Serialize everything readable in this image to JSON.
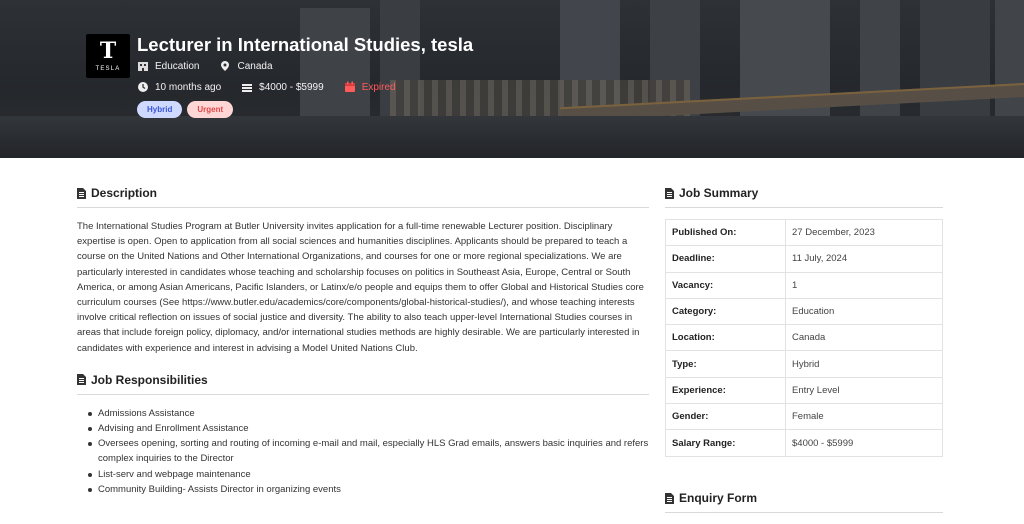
{
  "job": {
    "title": "Lecturer in International Studies, tesla",
    "company_logo_text": "TESLA",
    "category": "Education",
    "location": "Canada",
    "posted": "10 months ago",
    "salary": "$4000 - $5999",
    "status": "Expired",
    "badges": [
      "Hybrid",
      "Urgent"
    ]
  },
  "description": {
    "heading": "Description",
    "text": "The International Studies Program at Butler University invites application for a full-time renewable Lecturer position. Disciplinary expertise is open. Open to application from all social sciences and humanities disciplines. Applicants should be prepared to teach a course on the United Nations and Other International Organizations, and courses for one or more regional specializations. We are particularly interested in candidates whose teaching and scholarship focuses on politics in Southeast Asia, Europe, Central or South America, or among Asian Americans, Pacific Islanders, or Latinx/e/o people and equips them to offer Global and Historical Studies core curriculum courses (See https://www.butler.edu/academics/core/components/global-historical-studies/), and whose teaching interests involve critical reflection on issues of social justice and diversity. The ability to also teach upper-level International Studies courses in areas that include foreign policy, diplomacy, and/or international studies methods are highly desirable. We are particularly interested in candidates with experience and interest in advising a Model United Nations Club."
  },
  "responsibilities": {
    "heading": "Job Responsibilities",
    "items": [
      "Admissions Assistance",
      "Advising and Enrollment Assistance",
      "Oversees opening, sorting and routing of incoming e-mail and mail, especially HLS Grad emails, answers basic inquiries and refers complex inquiries to the Director",
      "List-serv and webpage maintenance",
      "Community Building- Assists Director in organizing events"
    ]
  },
  "summary": {
    "heading": "Job Summary",
    "rows": [
      {
        "label": "Published On:",
        "value": "27 December, 2023"
      },
      {
        "label": "Deadline:",
        "value": "11 July, 2024"
      },
      {
        "label": "Vacancy:",
        "value": "1"
      },
      {
        "label": "Category:",
        "value": "Education"
      },
      {
        "label": "Location:",
        "value": "Canada"
      },
      {
        "label": "Type:",
        "value": "Hybrid"
      },
      {
        "label": "Experience:",
        "value": "Entry Level"
      },
      {
        "label": "Gender:",
        "value": "Female"
      },
      {
        "label": "Salary Range:",
        "value": "$4000 - $5999"
      }
    ]
  },
  "enquiry": {
    "heading": "Enquiry Form"
  },
  "icons": {
    "document": "document-icon",
    "building": "building-icon",
    "location": "location-pin-icon",
    "clock": "clock-icon",
    "money": "money-icon",
    "calendar": "calendar-icon"
  },
  "colors": {
    "expired": "#ff5b5b",
    "hybrid_badge": "#cfd8ff",
    "urgent_badge": "#ffd6d6"
  }
}
